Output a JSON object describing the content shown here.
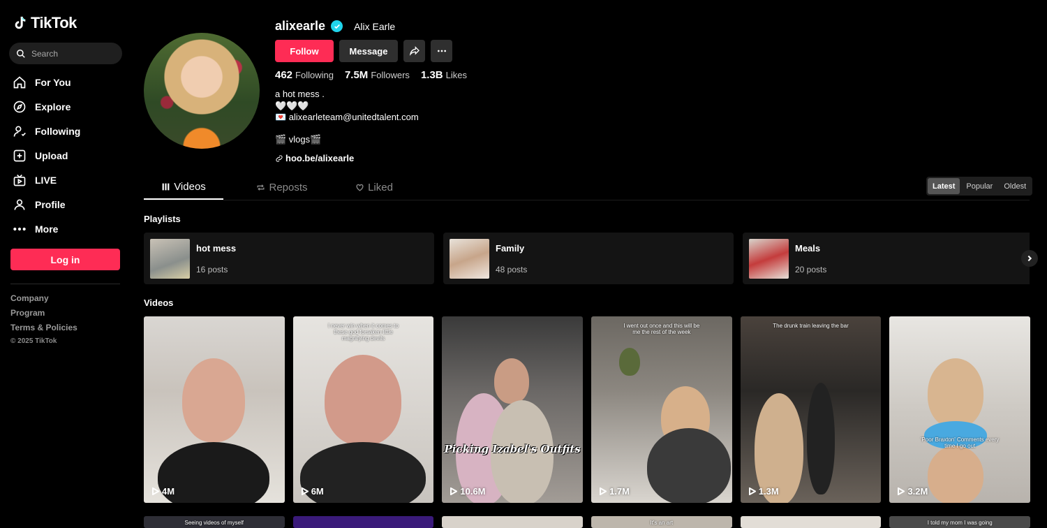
{
  "brand": {
    "name": "TikTok",
    "accent": "#fe2c55"
  },
  "search": {
    "placeholder": "Search"
  },
  "nav": [
    {
      "label": "For You",
      "icon": "home-icon"
    },
    {
      "label": "Explore",
      "icon": "compass-icon"
    },
    {
      "label": "Following",
      "icon": "following-icon"
    },
    {
      "label": "Upload",
      "icon": "upload-icon"
    },
    {
      "label": "LIVE",
      "icon": "live-icon"
    },
    {
      "label": "Profile",
      "icon": "profile-icon"
    },
    {
      "label": "More",
      "icon": "more-icon"
    }
  ],
  "login_label": "Log in",
  "footer": {
    "company": "Company",
    "program": "Program",
    "terms": "Terms & Policies",
    "copyright": "© 2025 TikTok"
  },
  "profile": {
    "username": "alixearle",
    "display_name": "Alix Earle",
    "follow_label": "Follow",
    "message_label": "Message",
    "stats": [
      {
        "value": "462",
        "label": "Following"
      },
      {
        "value": "7.5M",
        "label": "Followers"
      },
      {
        "value": "1.3B",
        "label": "Likes"
      }
    ],
    "bio": [
      "a hot mess .",
      "🤍🤍🤍",
      "💌 alixearleteam@unitedtalent.com"
    ],
    "vlogs": "🎬 vlogs🎬",
    "link": "hoo.be/alixearle"
  },
  "tabs": [
    {
      "label": "Videos",
      "active": true
    },
    {
      "label": "Reposts",
      "active": false
    },
    {
      "label": "Liked",
      "active": false
    }
  ],
  "sort": {
    "latest": "Latest",
    "popular": "Popular",
    "oldest": "Oldest",
    "selected": "Latest"
  },
  "playlists_title": "Playlists",
  "playlists": [
    {
      "name": "hot mess",
      "count": "16 posts"
    },
    {
      "name": "Family",
      "count": "48 posts"
    },
    {
      "name": "Meals",
      "count": "20 posts"
    }
  ],
  "videos_title": "Videos",
  "videos": [
    {
      "views": "4M",
      "caption": ""
    },
    {
      "views": "6M",
      "caption": "I never win when it comes to these god forsaken little magnifying devils"
    },
    {
      "views": "10.6M",
      "caption": "",
      "overlay": "Picking Izabel's Outfits"
    },
    {
      "views": "1.7M",
      "caption": "I went out once and this will be me the rest of the week"
    },
    {
      "views": "1.3M",
      "caption": "The drunk train leaving the bar"
    },
    {
      "views": "3.2M",
      "caption": "",
      "mid": "'Poor Braxton' Comments every time I go out"
    }
  ],
  "videos_row2": [
    {
      "caption": "Seeing videos of myself"
    },
    {
      "caption": ""
    },
    {
      "caption": ""
    },
    {
      "caption": "It's an art"
    },
    {
      "caption": ""
    },
    {
      "caption": "I told my mom I was going"
    }
  ]
}
